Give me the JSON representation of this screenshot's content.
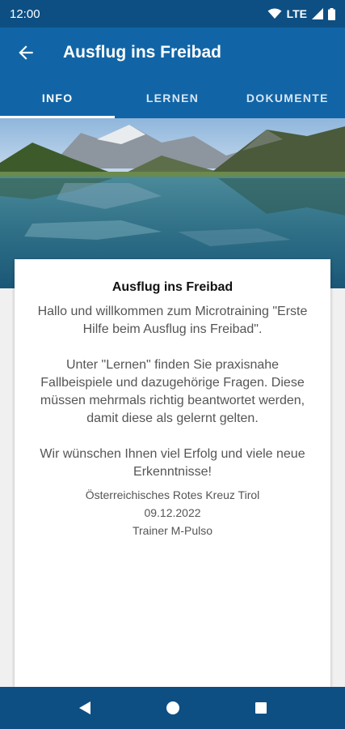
{
  "status_bar": {
    "time": "12:00",
    "network": "LTE",
    "icons": [
      "wifi-icon",
      "signal-icon",
      "battery-icon"
    ]
  },
  "app_bar": {
    "title": "Ausflug ins Freibad",
    "back_icon": "arrow-left-icon"
  },
  "tabs": [
    {
      "label": "INFO",
      "active": true
    },
    {
      "label": "LERNEN",
      "active": false
    },
    {
      "label": "DOKUMENTE",
      "active": false
    }
  ],
  "card": {
    "title": "Ausflug ins Freibad",
    "intro": "Hallo und willkommen zum Microtraining \"Erste Hilfe beim Ausflug ins Freibad\".",
    "lernen_info": "Unter \"Lernen\" finden Sie praxisnahe Fallbeispiele und dazugehörige Fragen. Diese müssen mehrmals richtig beantwortet werden, damit diese als gelernt gelten.",
    "wish": "Wir wünschen Ihnen viel Erfolg und viele neue Erkenntnisse!",
    "organization": "Österreichisches Rotes Kreuz Tirol",
    "date": "09.12.2022",
    "trainer": "Trainer M-Pulso"
  },
  "nav_bar": {
    "icons": [
      "back-triangle-icon",
      "home-circle-icon",
      "recents-square-icon"
    ]
  },
  "colors": {
    "app_bar": "#1165a6",
    "status_bar": "#0d4f83",
    "background": "#f0f0f0"
  }
}
